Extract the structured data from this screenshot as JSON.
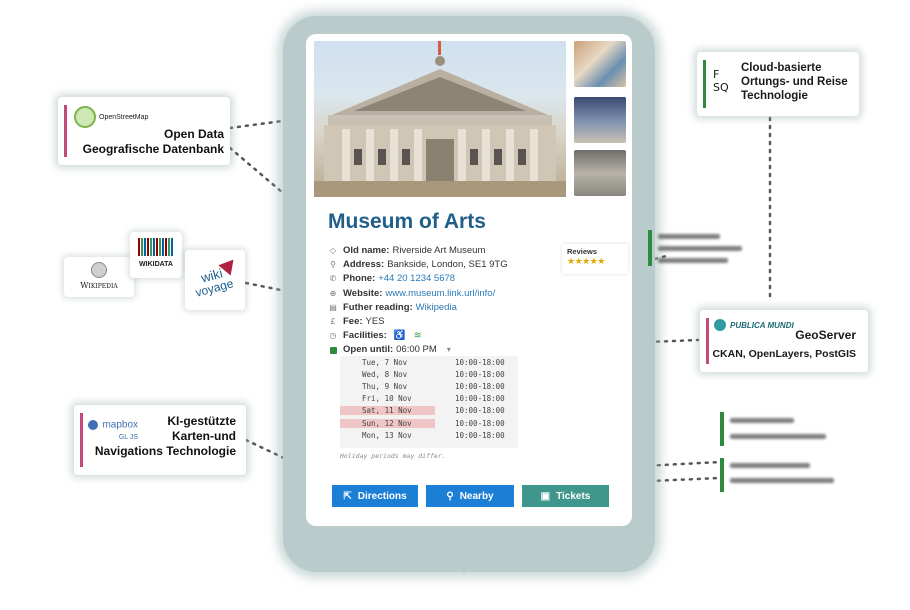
{
  "museum": {
    "title": "Museum of Arts",
    "info": [
      {
        "label": "Old name:",
        "value": "Riverside Art Museum",
        "icon": "tag-icon"
      },
      {
        "label": "Address:",
        "value": "Bankside, London, SE1 9TG",
        "icon": "location-pin-icon"
      },
      {
        "label": "Phone:",
        "value": "+44 20 1234 5678",
        "icon": "phone-icon"
      },
      {
        "label": "Website:",
        "value": "www.museum.link.url/info/",
        "icon": "globe-icon"
      },
      {
        "label": "Futher reading:",
        "value": "Wikipedia",
        "icon": "document-icon"
      },
      {
        "label": "Fee:",
        "value": "YES",
        "icon": "currency-icon"
      },
      {
        "label": "Facilities:",
        "value": "",
        "icon": "clock-icon"
      },
      {
        "label": "Open until:",
        "value": "06:00 PM",
        "icon": "status-icon"
      }
    ],
    "hours": [
      {
        "day": "Tue, 7 Nov",
        "time": "10:00-18:00",
        "holiday": false
      },
      {
        "day": "Wed, 8 Nov",
        "time": "10:00-18:00",
        "holiday": false
      },
      {
        "day": "Thu, 9 Nov",
        "time": "10:00-18:00",
        "holiday": false
      },
      {
        "day": "Fri, 10 Nov",
        "time": "10:00-18:00",
        "holiday": false
      },
      {
        "day": "Sat, 11 Nov",
        "time": "10:00-18:00",
        "holiday": true
      },
      {
        "day": "Sun, 12 Nov",
        "time": "10:00-18:00",
        "holiday": true
      },
      {
        "day": "Mon, 13 Nov",
        "time": "10:00-18:00",
        "holiday": false
      }
    ],
    "holiday_note": "Holiday periods may differ.",
    "reviews_label": "Reviews",
    "reviews_stars": "★★★★★",
    "rating": 4.5,
    "buttons": {
      "directions": "Directions",
      "nearby": "Nearby",
      "tickets": "Tickets"
    }
  },
  "cards": {
    "osm": {
      "logo": "OpenStreetMap",
      "line1": "Open Data",
      "line2": "Geografische Datenbank"
    },
    "wiki": {
      "wikipedia": "Wikipedia",
      "wikidata": "WIKIDATA",
      "wikivoyage_1": "wiki",
      "wikivoyage_2": "voyage"
    },
    "mapbox": {
      "logo": "mapbox",
      "logo_sub": "GL JS",
      "line1": "KI-gestützte",
      "line2": "Karten-und",
      "line3": "Navigations Technologie"
    },
    "fsq": {
      "logo_1": "F",
      "logo_2": "SQ",
      "line1": "Cloud-basierte",
      "line2": "Ortungs- und Reise",
      "line3": "Technologie"
    },
    "geoserver": {
      "logo": "PUBLICA MUNDI",
      "title": "GeoServer",
      "subtitle": "CKAN, OpenLayers, PostGIS"
    }
  },
  "colors": {
    "osm_bar": "#c2497a",
    "mapbox_bar": "#c2497a",
    "fsq_bar": "#2e8b3e",
    "geoserver_bar": "#c2497a",
    "title": "#1f5f8a",
    "button_blue": "#1c7fd6",
    "button_teal": "#3e968d"
  }
}
